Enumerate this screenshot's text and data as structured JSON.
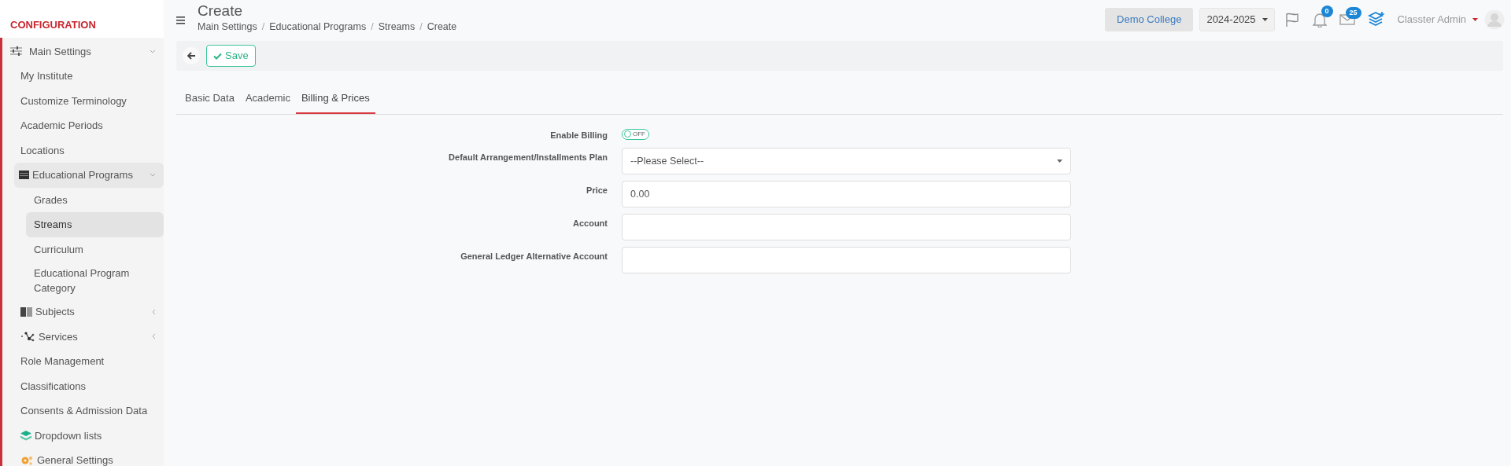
{
  "sidebar": {
    "heading": "CONFIGURATION",
    "items": [
      {
        "label": "Main Settings",
        "expanded": true,
        "selected": false,
        "children": [
          {
            "label": "My Institute",
            "selected": false
          },
          {
            "label": "Customize Terminology",
            "selected": false
          },
          {
            "label": "Academic Periods",
            "selected": false
          },
          {
            "label": "Locations",
            "selected": false
          },
          {
            "label": "Educational Programs",
            "expanded": true,
            "selected": false,
            "children": [
              {
                "label": "Grades",
                "selected": false
              },
              {
                "label": "Streams",
                "selected": true
              },
              {
                "label": "Curriculum",
                "selected": false
              },
              {
                "label": "Educational Program Category",
                "selected": false
              }
            ]
          },
          {
            "label": "Subjects",
            "expanded": false,
            "selected": false
          },
          {
            "label": "Services",
            "expanded": false,
            "selected": false
          },
          {
            "label": "Role Management",
            "selected": false
          },
          {
            "label": "Classifications",
            "selected": false
          },
          {
            "label": "Consents & Admission Data",
            "selected": false
          },
          {
            "label": "Dropdown lists",
            "selected": false
          },
          {
            "label": "General Settings",
            "selected": false
          }
        ]
      }
    ]
  },
  "header": {
    "title": "Create",
    "breadcrumb": [
      "Main Settings",
      "Educational Programs",
      "Streams",
      "Create"
    ],
    "breadcrumb_separator": "/",
    "college": "Demo College",
    "year": "2024-2025",
    "notifications": "0",
    "messages": "25",
    "user": "Classter Admin"
  },
  "toolbar": {
    "save": "Save"
  },
  "tabs": [
    {
      "label": "Basic Data",
      "selected": false
    },
    {
      "label": "Academic",
      "selected": false
    },
    {
      "label": "Billing & Prices",
      "selected": true
    }
  ],
  "form": [
    {
      "kind": "toggle",
      "label": "Enable Billing",
      "on": false,
      "state_label": "OFF"
    },
    {
      "kind": "select",
      "label": "Default Arrangement/Installments Plan",
      "placeholder": "--Please Select--"
    },
    {
      "kind": "input",
      "label": "Price",
      "value": "0.00"
    },
    {
      "kind": "input",
      "label": "Account"
    },
    {
      "kind": "input",
      "label": "General Ledger Alternative Account"
    }
  ]
}
